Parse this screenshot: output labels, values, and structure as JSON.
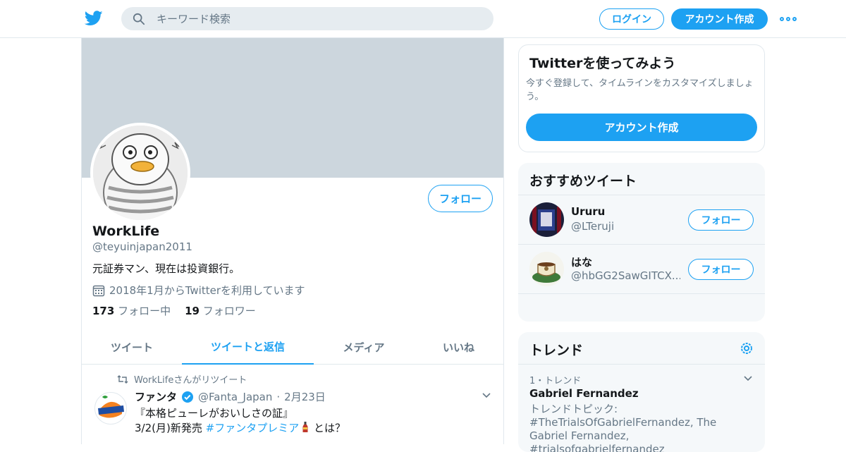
{
  "header": {
    "search_placeholder": "キーワード検索",
    "login_label": "ログイン",
    "signup_label": "アカウント作成"
  },
  "profile": {
    "name": "WorkLife",
    "handle": "@teyuinjapan2011",
    "bio": "元証券マン、現在は投資銀行。",
    "joined": "2018年1月からTwitterを利用しています",
    "following_count": "173",
    "following_label": "フォロー中",
    "followers_count": "19",
    "followers_label": "フォロワー",
    "follow_label": "フォロー"
  },
  "tabs": [
    {
      "label": "ツイート",
      "active": false
    },
    {
      "label": "ツイートと返信",
      "active": true
    },
    {
      "label": "メディア",
      "active": false
    },
    {
      "label": "いいね",
      "active": false
    }
  ],
  "tweet": {
    "retweet_context": "WorkLifeさんがリツイート",
    "author_name": "ファンタ",
    "author_handle": "@Fanta_Japan",
    "date": "2月23日",
    "line1": "『本格ピューレがおいしさの証』",
    "line2_prefix": "3/2(月)新発売 ",
    "hashtag": "#ファンタプレミア",
    "line2_suffix": " とは？"
  },
  "signup_card": {
    "title": "Twitterを使ってみよう",
    "text": "今すぐ登録して、タイムラインをカスタマイズしましょう。",
    "button": "アカウント作成"
  },
  "recommend": {
    "title": "おすすめツイート",
    "users": [
      {
        "name": "Ururu",
        "handle": "@LTeruji",
        "follow": "フォロー"
      },
      {
        "name": "はな",
        "handle": "@hbGG2SawGITCX...",
        "follow": "フォロー"
      }
    ]
  },
  "trends": {
    "title": "トレンド",
    "items": [
      {
        "meta": "1・トレンド",
        "name": "Gabriel Fernandez",
        "topic": "トレンドトピック: #TheTrialsOfGabrielFernandez, The Gabriel Fernandez, #trialsofgabrielfernandez"
      }
    ]
  },
  "colors": {
    "accent": "#1da1f2",
    "banner": "#ccd6dd",
    "muted": "#657786"
  }
}
